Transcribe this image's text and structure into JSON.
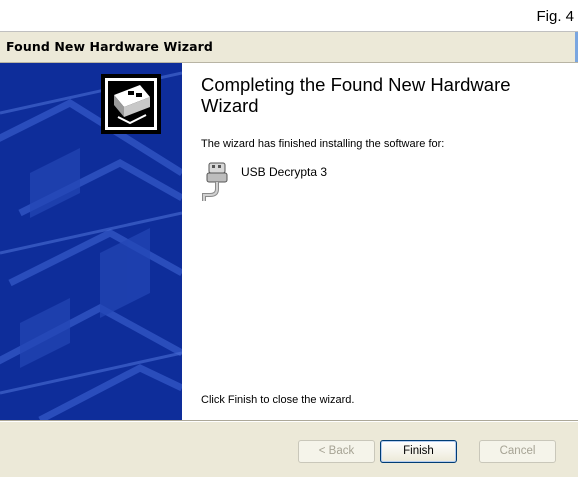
{
  "figure_label": "Fig. 4",
  "window": {
    "title": "Found New Hardware Wizard"
  },
  "main": {
    "heading": "Completing the Found New Hardware Wizard",
    "description": "The wizard has finished installing the software for:",
    "device": {
      "name": "USB Decrypta 3",
      "icon": "usb-plug-icon"
    },
    "close_instruction": "Click Finish to close the wizard."
  },
  "banner": {
    "icon": "hardware-card-icon"
  },
  "buttons": {
    "back": "< Back",
    "finish": "Finish",
    "cancel": "Cancel"
  },
  "colors": {
    "banner": "#0e2d9a",
    "window": "#ece9d8",
    "focus": "#003c74"
  }
}
